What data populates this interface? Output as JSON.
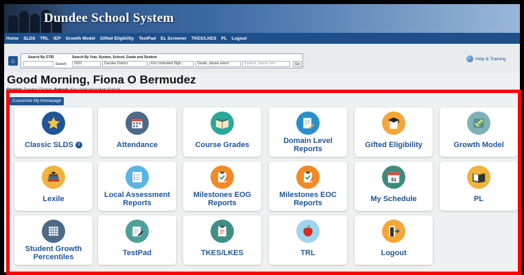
{
  "header": {
    "title": "Dundee School System"
  },
  "nav": [
    "Home",
    "SLDS",
    "TRL",
    "IEP",
    "Growth Model",
    "Gifted Eligibility",
    "TestPad",
    "EL Screener",
    "TKES/LKES",
    "PL",
    "Logout"
  ],
  "search": {
    "gtid_label": "Search By GTID",
    "gtid_button": "Search",
    "filters_label": "Search By Year, System, School, Grade and Student",
    "year": "2020",
    "system": "Dundee District",
    "school": "Kim Undivided High...",
    "grade": "Grade, please select",
    "student_placeholder": "Student, please sele",
    "go_button": "Go"
  },
  "help": {
    "label": "Help & Training"
  },
  "greeting": "Good Morning, Fiona O Bermudez",
  "district": {
    "district_label": "District:",
    "district_value": "Dundee District",
    "school_label": "School:",
    "school_value": "Kim Undivided High School"
  },
  "customize": {
    "label": "Customize My Homepage"
  },
  "tiles": [
    {
      "label": "Classic SLDS",
      "icon": "star-icon",
      "color": "#1f5597",
      "info": "i"
    },
    {
      "label": "Attendance",
      "icon": "calendar-icon",
      "color": "#4d6a87"
    },
    {
      "label": "Course Grades",
      "icon": "book-icon",
      "color": "#2aa89a"
    },
    {
      "label": "Domain Level Reports",
      "icon": "report-pen-icon",
      "color": "#2a8fc7"
    },
    {
      "label": "Gifted Eligibility",
      "icon": "graduation-cap-icon",
      "color": "#f3a63a"
    },
    {
      "label": "Growth Model",
      "icon": "growth-chart-icon",
      "color": "#7fb2b7"
    },
    {
      "label": "Lexile",
      "icon": "books-icon",
      "color": "#f0b33c"
    },
    {
      "label": "Local Assessment Reports",
      "icon": "checklist-icon",
      "color": "#58b5e4"
    },
    {
      "label": "Milestones EOG Reports",
      "icon": "clipboard-check-icon",
      "color": "#f08a24"
    },
    {
      "label": "Milestones EOC Reports",
      "icon": "clipboard-check-icon",
      "color": "#f08a24"
    },
    {
      "label": "My Schedule",
      "icon": "calendar-31-icon",
      "color": "#3e8a7e",
      "day": "31"
    },
    {
      "label": "PL",
      "icon": "open-book-icon",
      "color": "#f0b33c"
    },
    {
      "label": "Student Growth Percentiles",
      "icon": "grid-icon",
      "color": "#4d6a87"
    },
    {
      "label": "TestPad",
      "icon": "notepad-pencil-icon",
      "color": "#4f9f9a"
    },
    {
      "label": "TKES/LKES",
      "icon": "clipboard-icon",
      "color": "#3f8f88"
    },
    {
      "label": "TRL",
      "icon": "apple-icon",
      "color": "#9fd3f0"
    },
    {
      "label": "Logout",
      "icon": "door-exit-icon",
      "color": "#f3a63a"
    }
  ]
}
